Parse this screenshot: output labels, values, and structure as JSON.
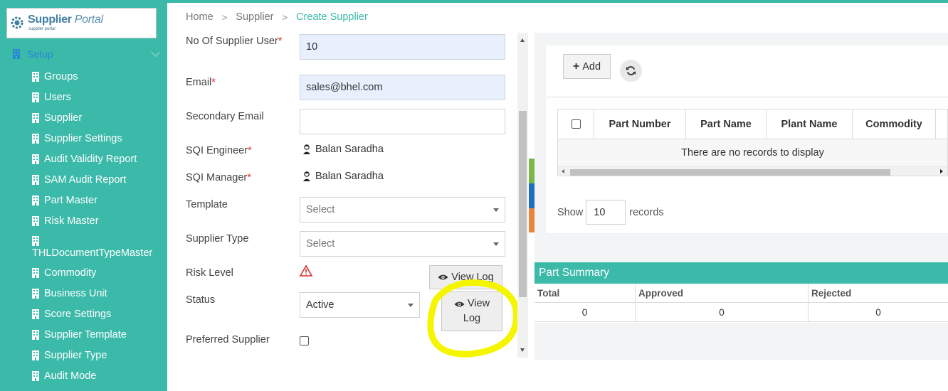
{
  "app": {
    "logo_title": "Supplier",
    "logo_title_italic": "Portal",
    "logo_subtitle": "supplier portal"
  },
  "sidebar": {
    "section_label": "Setup",
    "items": [
      {
        "label": "Groups"
      },
      {
        "label": "Users"
      },
      {
        "label": "Supplier"
      },
      {
        "label": "Supplier Settings"
      },
      {
        "label": "Audit Validity Report"
      },
      {
        "label": "SAM Audit Report"
      },
      {
        "label": "Part Master"
      },
      {
        "label": "Risk Master"
      },
      {
        "label": "THLDocumentTypeMaster"
      },
      {
        "label": "Commodity"
      },
      {
        "label": "Business Unit"
      },
      {
        "label": "Score Settings"
      },
      {
        "label": "Supplier Template"
      },
      {
        "label": "Supplier Type"
      },
      {
        "label": "Audit Mode"
      }
    ]
  },
  "breadcrumb": {
    "home": "Home",
    "supplier": "Supplier",
    "current": "Create Supplier",
    "separator": ">"
  },
  "form": {
    "no_of_users_label": "No Of Supplier User",
    "no_of_users_value": "10",
    "email_label": "Email",
    "email_value": "sales@bhel.com",
    "secondary_email_label": "Secondary Email",
    "secondary_email_value": "",
    "sqi_engineer_label": "SQI Engineer",
    "sqi_engineer_value": "Balan Saradha",
    "sqi_manager_label": "SQI Manager",
    "sqi_manager_value": "Balan Saradha",
    "template_label": "Template",
    "template_value": "Select",
    "supplier_type_label": "Supplier Type",
    "supplier_type_value": "Select",
    "risk_level_label": "Risk Level",
    "status_label": "Status",
    "status_value": "Active",
    "preferred_label": "Preferred Supplier",
    "preferred_checked": false,
    "required_mark": "*",
    "view_log_1": "View Log",
    "view_log_2": "View Log"
  },
  "parts": {
    "add_label": "Add",
    "columns": [
      "Part Number",
      "Part Name",
      "Plant Name",
      "Commodity"
    ],
    "empty_message": "There are no records to display",
    "show_label": "Show",
    "page_size": "10",
    "records_label": "records"
  },
  "part_summary": {
    "title": "Part Summary",
    "columns": [
      "Total",
      "Approved",
      "Rejected"
    ],
    "values": [
      "0",
      "0",
      "0"
    ]
  },
  "colors": {
    "accent": "#3bb9a9",
    "required": "#e03030",
    "highlight": "#f5f500",
    "strip_green": "#7ab648",
    "strip_blue": "#1f6fc1",
    "strip_orange": "#e8843b"
  },
  "icons": {
    "logo": "gear-people-icon",
    "nav": "building-icon",
    "person": "user-icon",
    "warning": "warning-triangle-icon",
    "eye": "eye-icon",
    "refresh": "refresh-icon",
    "add": "plus-icon"
  }
}
